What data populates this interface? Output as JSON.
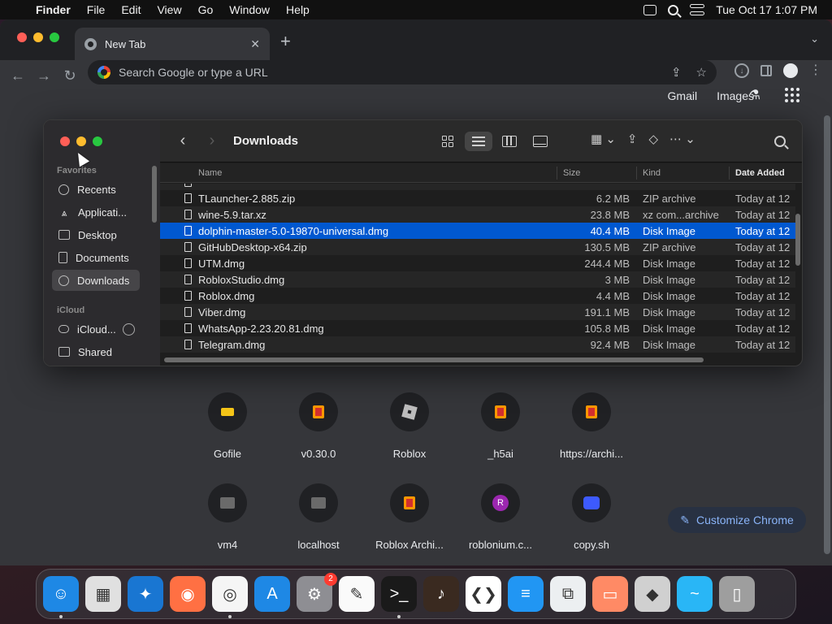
{
  "menubar": {
    "app": "Finder",
    "items": [
      "File",
      "Edit",
      "View",
      "Go",
      "Window",
      "Help"
    ],
    "datetime": "Tue Oct 17  1:07 PM"
  },
  "chrome": {
    "tab_title": "New Tab",
    "omnibox_placeholder": "Search Google or type a URL",
    "links": [
      "Gmail",
      "Images"
    ],
    "customize_label": "Customize Chrome",
    "shortcuts": [
      {
        "label": "Gofile",
        "icon": "gofile-icon"
      },
      {
        "label": "v0.30.0",
        "icon": "bookmark-red-icon"
      },
      {
        "label": "Roblox",
        "icon": "roblox-icon"
      },
      {
        "label": "_h5ai",
        "icon": "bookmark-red-icon"
      },
      {
        "label": "https://archi...",
        "icon": "bookmark-red-icon"
      },
      {
        "label": "vm4",
        "icon": "folder-icon"
      },
      {
        "label": "localhost",
        "icon": "folder-icon"
      },
      {
        "label": "Roblox Archi...",
        "icon": "bookmark-red-icon"
      },
      {
        "label": "roblonium.c...",
        "icon": "r-letter-icon",
        "letter": "R"
      },
      {
        "label": "copy.sh",
        "icon": "invader-icon"
      }
    ]
  },
  "finder": {
    "title": "Downloads",
    "sidebar": {
      "favorites_heading": "Favorites",
      "favorites": [
        {
          "label": "Recents",
          "icon": "clock-icon"
        },
        {
          "label": "Applicati...",
          "icon": "apps-icon"
        },
        {
          "label": "Desktop",
          "icon": "desktop-icon"
        },
        {
          "label": "Documents",
          "icon": "document-icon"
        },
        {
          "label": "Downloads",
          "icon": "download-icon",
          "selected": true
        }
      ],
      "icloud_heading": "iCloud",
      "icloud": [
        {
          "label": "iCloud...",
          "icon": "cloud-icon"
        },
        {
          "label": "Shared",
          "icon": "shared-folder-icon"
        }
      ]
    },
    "columns": {
      "name": "Name",
      "size": "Size",
      "kind": "Kind",
      "date": "Date Added"
    },
    "files": [
      {
        "name": "TLauncher-2.885.zip",
        "size": "6.2 MB",
        "kind": "ZIP archive",
        "date": "Today at 12"
      },
      {
        "name": "wine-5.9.tar.xz",
        "size": "23.8 MB",
        "kind": "xz com...archive",
        "date": "Today at 12"
      },
      {
        "name": "dolphin-master-5.0-19870-universal.dmg",
        "size": "40.4 MB",
        "kind": "Disk Image",
        "date": "Today at 12",
        "selected": true
      },
      {
        "name": "GitHubDesktop-x64.zip",
        "size": "130.5 MB",
        "kind": "ZIP archive",
        "date": "Today at 12"
      },
      {
        "name": "UTM.dmg",
        "size": "244.4 MB",
        "kind": "Disk Image",
        "date": "Today at 12"
      },
      {
        "name": "RobloxStudio.dmg",
        "size": "3 MB",
        "kind": "Disk Image",
        "date": "Today at 12"
      },
      {
        "name": "Roblox.dmg",
        "size": "4.4 MB",
        "kind": "Disk Image",
        "date": "Today at 12"
      },
      {
        "name": "Viber.dmg",
        "size": "191.1 MB",
        "kind": "Disk Image",
        "date": "Today at 12"
      },
      {
        "name": "WhatsApp-2.23.20.81.dmg",
        "size": "105.8 MB",
        "kind": "Disk Image",
        "date": "Today at 12"
      },
      {
        "name": "Telegram.dmg",
        "size": "92.4 MB",
        "kind": "Disk Image",
        "date": "Today at 12"
      }
    ]
  },
  "dock": {
    "apps": [
      {
        "name": "finder",
        "color": "#1e88e5"
      },
      {
        "name": "launchpad",
        "color": "#e0e0e0"
      },
      {
        "name": "safari",
        "color": "#1976d2"
      },
      {
        "name": "firefox",
        "color": "#ff7043"
      },
      {
        "name": "chrome",
        "color": "#f5f5f5"
      },
      {
        "name": "app-store",
        "color": "#1e88e5"
      },
      {
        "name": "system-settings",
        "color": "#8e8e93",
        "badge": "2"
      },
      {
        "name": "textedit",
        "color": "#fafafa"
      },
      {
        "name": "terminal",
        "color": "#1a1a1a"
      },
      {
        "name": "garageband",
        "color": "#3a2a20"
      },
      {
        "name": "vscode",
        "color": "#ffffff"
      },
      {
        "name": "stack-app",
        "color": "#2196f3"
      },
      {
        "name": "virtualbox",
        "color": "#eceff1"
      },
      {
        "name": "vm-app",
        "color": "#ff8a65"
      },
      {
        "name": "roblox",
        "color": "#d0d0d0"
      },
      {
        "name": "dolphin",
        "color": "#29b6f6"
      },
      {
        "name": "trash",
        "color": "#9e9e9e"
      }
    ]
  }
}
